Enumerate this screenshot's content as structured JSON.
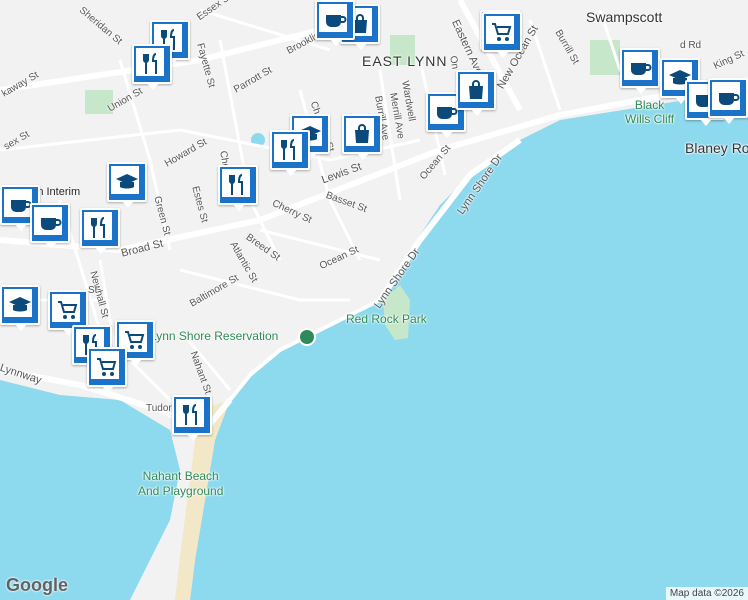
{
  "map": {
    "areas": {
      "east_lynn": "EAST LYNN",
      "swampscott": "Swampscott",
      "black_wills_cliff": "Black\nWills Cliff",
      "blaney": "Blaney Ro",
      "lynn_interim": "Lynn Interim",
      "nahant_beach": "Nahant Beach\nAnd Playground"
    },
    "parks": {
      "red_rock": "Red Rock Park",
      "lynn_shore": "Lynn Shore Reservation"
    },
    "streets": [
      {
        "id": "sheridan",
        "text": "Sheridan St"
      },
      {
        "id": "essex",
        "text": "Essex St"
      },
      {
        "id": "kaway",
        "text": "kaway St"
      },
      {
        "id": "union",
        "text": "Union St"
      },
      {
        "id": "fayette",
        "text": "Fayette St"
      },
      {
        "id": "parrott",
        "text": "Parrott St"
      },
      {
        "id": "brookline",
        "text": "Brookline"
      },
      {
        "id": "chatham",
        "text": "Chatham St"
      },
      {
        "id": "sex",
        "text": "sex St"
      },
      {
        "id": "howard",
        "text": "Howard St"
      },
      {
        "id": "lewis",
        "text": "Lewis St"
      },
      {
        "id": "chestnut",
        "text": "Chestnut St"
      },
      {
        "id": "basset",
        "text": "Basset St"
      },
      {
        "id": "cherry",
        "text": "Cherry St"
      },
      {
        "id": "green",
        "text": "Green St"
      },
      {
        "id": "estes",
        "text": "Estes St"
      },
      {
        "id": "broad",
        "text": "Broad St"
      },
      {
        "id": "breed",
        "text": "Breed St"
      },
      {
        "id": "atlantic",
        "text": "Atlantic St"
      },
      {
        "id": "ocean1",
        "text": "Ocean St"
      },
      {
        "id": "ocean2",
        "text": "Ocean St"
      },
      {
        "id": "baltimore",
        "text": "Baltimore St"
      },
      {
        "id": "newhall",
        "text": "Newhall St"
      },
      {
        "id": "lynnshore1",
        "text": "Lynn Shore Dr"
      },
      {
        "id": "lynnshore2",
        "text": "Lynn Shore Dr"
      },
      {
        "id": "eastern",
        "text": "Eastern Ave"
      },
      {
        "id": "newocean",
        "text": "New Ocean St"
      },
      {
        "id": "burrill",
        "text": "Burrill St"
      },
      {
        "id": "burrillave",
        "text": "Burrill Ave"
      },
      {
        "id": "merrill",
        "text": "Merrill Ave"
      },
      {
        "id": "wardwell",
        "text": "Wardwell"
      },
      {
        "id": "ons",
        "text": "On"
      },
      {
        "id": "nahant",
        "text": "Nahant St"
      },
      {
        "id": "tudor",
        "text": "Tudor"
      },
      {
        "id": "lynnway",
        "text": "Lynnway"
      },
      {
        "id": "st",
        "text": "St"
      },
      {
        "id": "rd",
        "text": "d Rd"
      },
      {
        "id": "king",
        "text": "King St"
      }
    ]
  },
  "markers": [
    {
      "id": "m1",
      "icon": "shopping-bag-icon"
    },
    {
      "id": "m2",
      "icon": "coffee-icon"
    },
    {
      "id": "m3",
      "icon": "shopping-cart-icon"
    },
    {
      "id": "m4",
      "icon": "restaurant-icon"
    },
    {
      "id": "m5",
      "icon": "restaurant-icon"
    },
    {
      "id": "m6",
      "icon": "school-icon"
    },
    {
      "id": "m7",
      "icon": "shopping-bag-icon"
    },
    {
      "id": "m8",
      "icon": "restaurant-icon"
    },
    {
      "id": "m9",
      "icon": "restaurant-icon"
    },
    {
      "id": "m10",
      "icon": "school-icon"
    },
    {
      "id": "m11",
      "icon": "coffee-icon"
    },
    {
      "id": "m12",
      "icon": "coffee-icon"
    },
    {
      "id": "m13",
      "icon": "restaurant-icon"
    },
    {
      "id": "m14",
      "icon": "school-icon"
    },
    {
      "id": "m15",
      "icon": "shopping-cart-icon"
    },
    {
      "id": "m16",
      "icon": "shopping-cart-icon"
    },
    {
      "id": "m17",
      "icon": "restaurant-icon"
    },
    {
      "id": "m18",
      "icon": "shopping-cart-icon"
    },
    {
      "id": "m19",
      "icon": "restaurant-icon"
    },
    {
      "id": "m20",
      "icon": "coffee-icon"
    },
    {
      "id": "m21",
      "icon": "shopping-bag-icon"
    },
    {
      "id": "m22",
      "icon": "shopping-cart-icon"
    },
    {
      "id": "m23",
      "icon": "coffee-icon"
    },
    {
      "id": "m24",
      "icon": "school-icon"
    },
    {
      "id": "m25",
      "icon": "coffee-icon"
    },
    {
      "id": "m26",
      "icon": "coffee-icon"
    }
  ],
  "logo": "Google",
  "attribution": "Map data ©2026"
}
